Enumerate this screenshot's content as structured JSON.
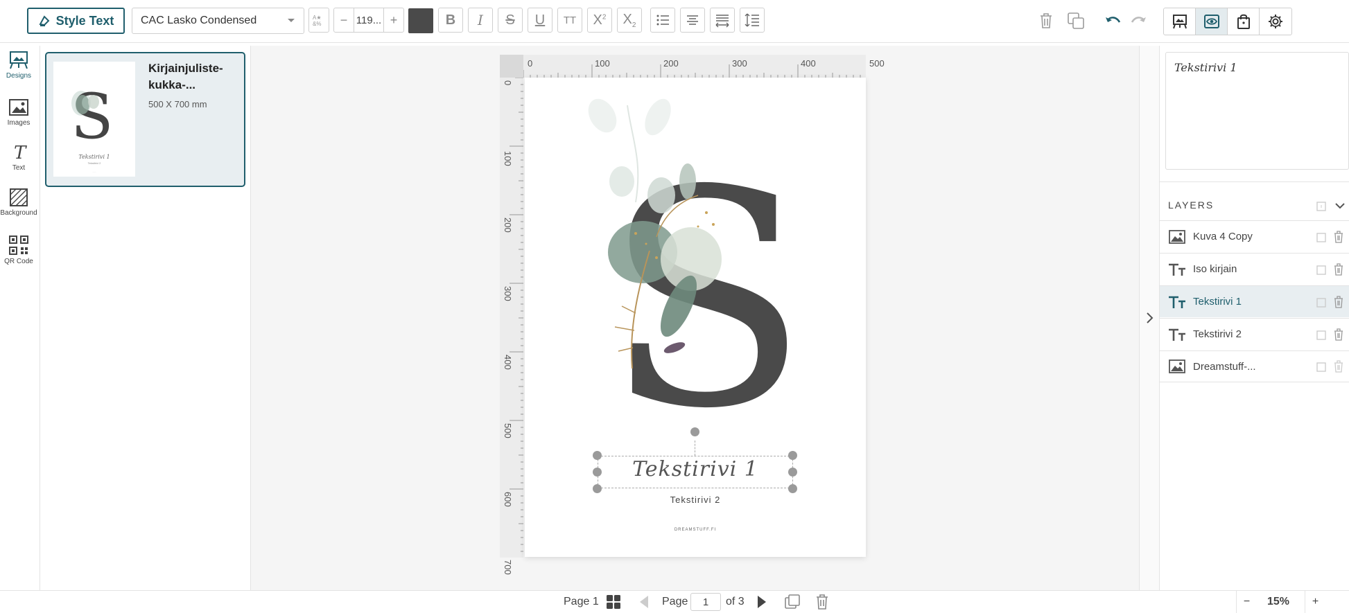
{
  "toolbar": {
    "style_text_label": "Style Text",
    "font_family_value": "CAC Lasko Condensed",
    "font_size_value": "119...",
    "text_color": "#4a4a4a"
  },
  "left_nav": {
    "items": [
      {
        "label": "Designs",
        "icon": "designs-icon",
        "active": true
      },
      {
        "label": "Images",
        "icon": "image-icon"
      },
      {
        "label": "Text",
        "icon": "text-icon"
      },
      {
        "label": "Background",
        "icon": "background-icon"
      },
      {
        "label": "QR Code",
        "icon": "qr-code-icon"
      }
    ]
  },
  "design_card": {
    "title": "Kirjainjuliste-kukka-...",
    "size": "500 X 700 mm"
  },
  "ruler": {
    "top": [
      "0",
      "100",
      "200",
      "300",
      "400",
      "500"
    ],
    "left": [
      "0",
      "100",
      "200",
      "300",
      "400",
      "500",
      "600",
      "700"
    ]
  },
  "canvas": {
    "text1": "Tekstirivi 1",
    "text2": "Tekstirivi 2",
    "footer": "DREAMSTUFF.FI"
  },
  "preview": {
    "text": "Tekstirivi 1"
  },
  "layers": {
    "title": "LAYERS",
    "items": [
      {
        "label": "Kuva 4 Copy",
        "type": "image"
      },
      {
        "label": "Iso kirjain",
        "type": "text"
      },
      {
        "label": "Tekstirivi 1",
        "type": "text",
        "active": true
      },
      {
        "label": "Tekstirivi 2",
        "type": "text"
      },
      {
        "label": "Dreamstuff-...",
        "type": "image"
      }
    ]
  },
  "bottom": {
    "page_label": "Page 1",
    "page_word": "Page",
    "page_value": "1",
    "of_label": "of 3",
    "zoom": "15%"
  },
  "colors": {
    "accent": "#1f5e6c",
    "active_row": "#e8eef1"
  }
}
